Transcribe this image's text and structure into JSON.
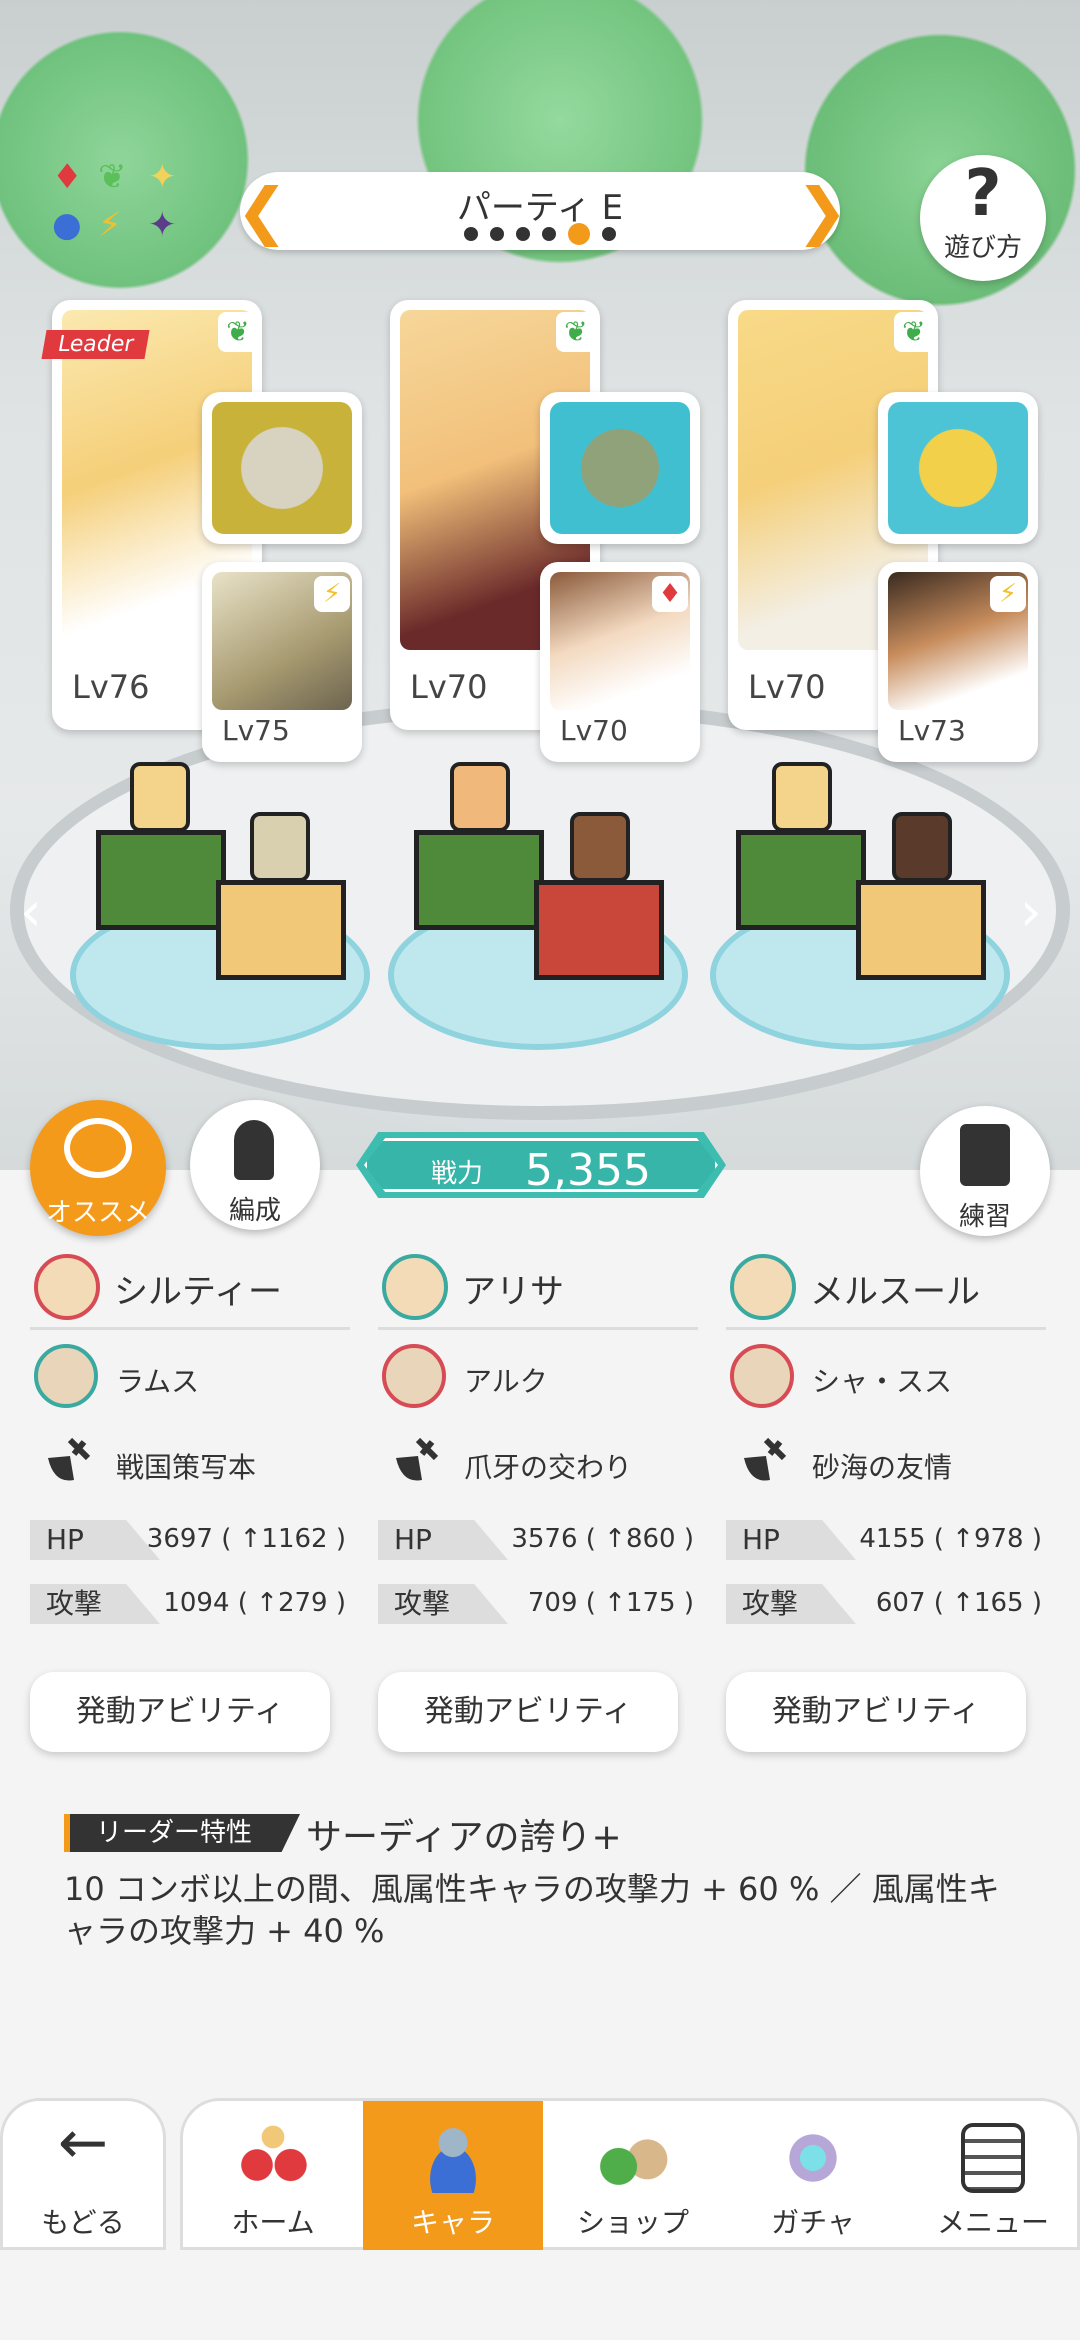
{
  "party": {
    "title": "パーティ E",
    "dot_count": 6,
    "active_dot_index": 4
  },
  "help": {
    "icon": "?",
    "label": "遊び方"
  },
  "leader_label": "Leader",
  "units": [
    {
      "main_level": "Lv76",
      "main_attr": "wind",
      "sub_level": "Lv75",
      "sub_attr": "thunder"
    },
    {
      "main_level": "Lv70",
      "main_attr": "wind",
      "sub_level": "Lv70",
      "sub_attr": "fire"
    },
    {
      "main_level": "Lv70",
      "main_attr": "wind",
      "sub_level": "Lv73",
      "sub_attr": "thunder"
    }
  ],
  "buttons": {
    "osusume": "オススメ",
    "hensei": "編成",
    "renshu": "練習"
  },
  "power": {
    "label": "戦力",
    "value": "5,355"
  },
  "columns": [
    {
      "name": "シルティー",
      "sub_name": "ラムス",
      "equip": "戦国策写本",
      "hp_label": "HP",
      "hp": "3697 ( ↑1162 )",
      "atk_label": "攻撃",
      "atk": "1094 ( ↑279 )",
      "ability": "発動アビリティ"
    },
    {
      "name": "アリサ",
      "sub_name": "アルク",
      "equip": "爪牙の交わり",
      "hp_label": "HP",
      "hp": "3576 ( ↑860 )",
      "atk_label": "攻撃",
      "atk": "709 ( ↑175 )",
      "ability": "発動アビリティ"
    },
    {
      "name": "メルスール",
      "sub_name": "シャ・スス",
      "equip": "砂海の友情",
      "hp_label": "HP",
      "hp": "4155 ( ↑978 )",
      "atk_label": "攻撃",
      "atk": "607 ( ↑165 )",
      "ability": "発動アビリティ"
    }
  ],
  "leader_skill": {
    "tag": "リーダー特性",
    "name": "サーディアの誇り+",
    "description": "10 コンボ以上の間、風属性キャラの攻撃力 + 60 % ／ 風属性キャラの攻撃力 + 40 %"
  },
  "nav": {
    "back": "もどる",
    "tabs": [
      {
        "label": "ホーム",
        "icon": "home-icon"
      },
      {
        "label": "キャラ",
        "icon": "character-icon",
        "active": true
      },
      {
        "label": "ショップ",
        "icon": "shop-icon"
      },
      {
        "label": "ガチャ",
        "icon": "gacha-icon"
      },
      {
        "label": "メニュー",
        "icon": "menu-icon"
      }
    ]
  },
  "colors": {
    "accent": "#f39a1b",
    "power": "#3dbdb0",
    "leader_red": "#e0393e"
  }
}
